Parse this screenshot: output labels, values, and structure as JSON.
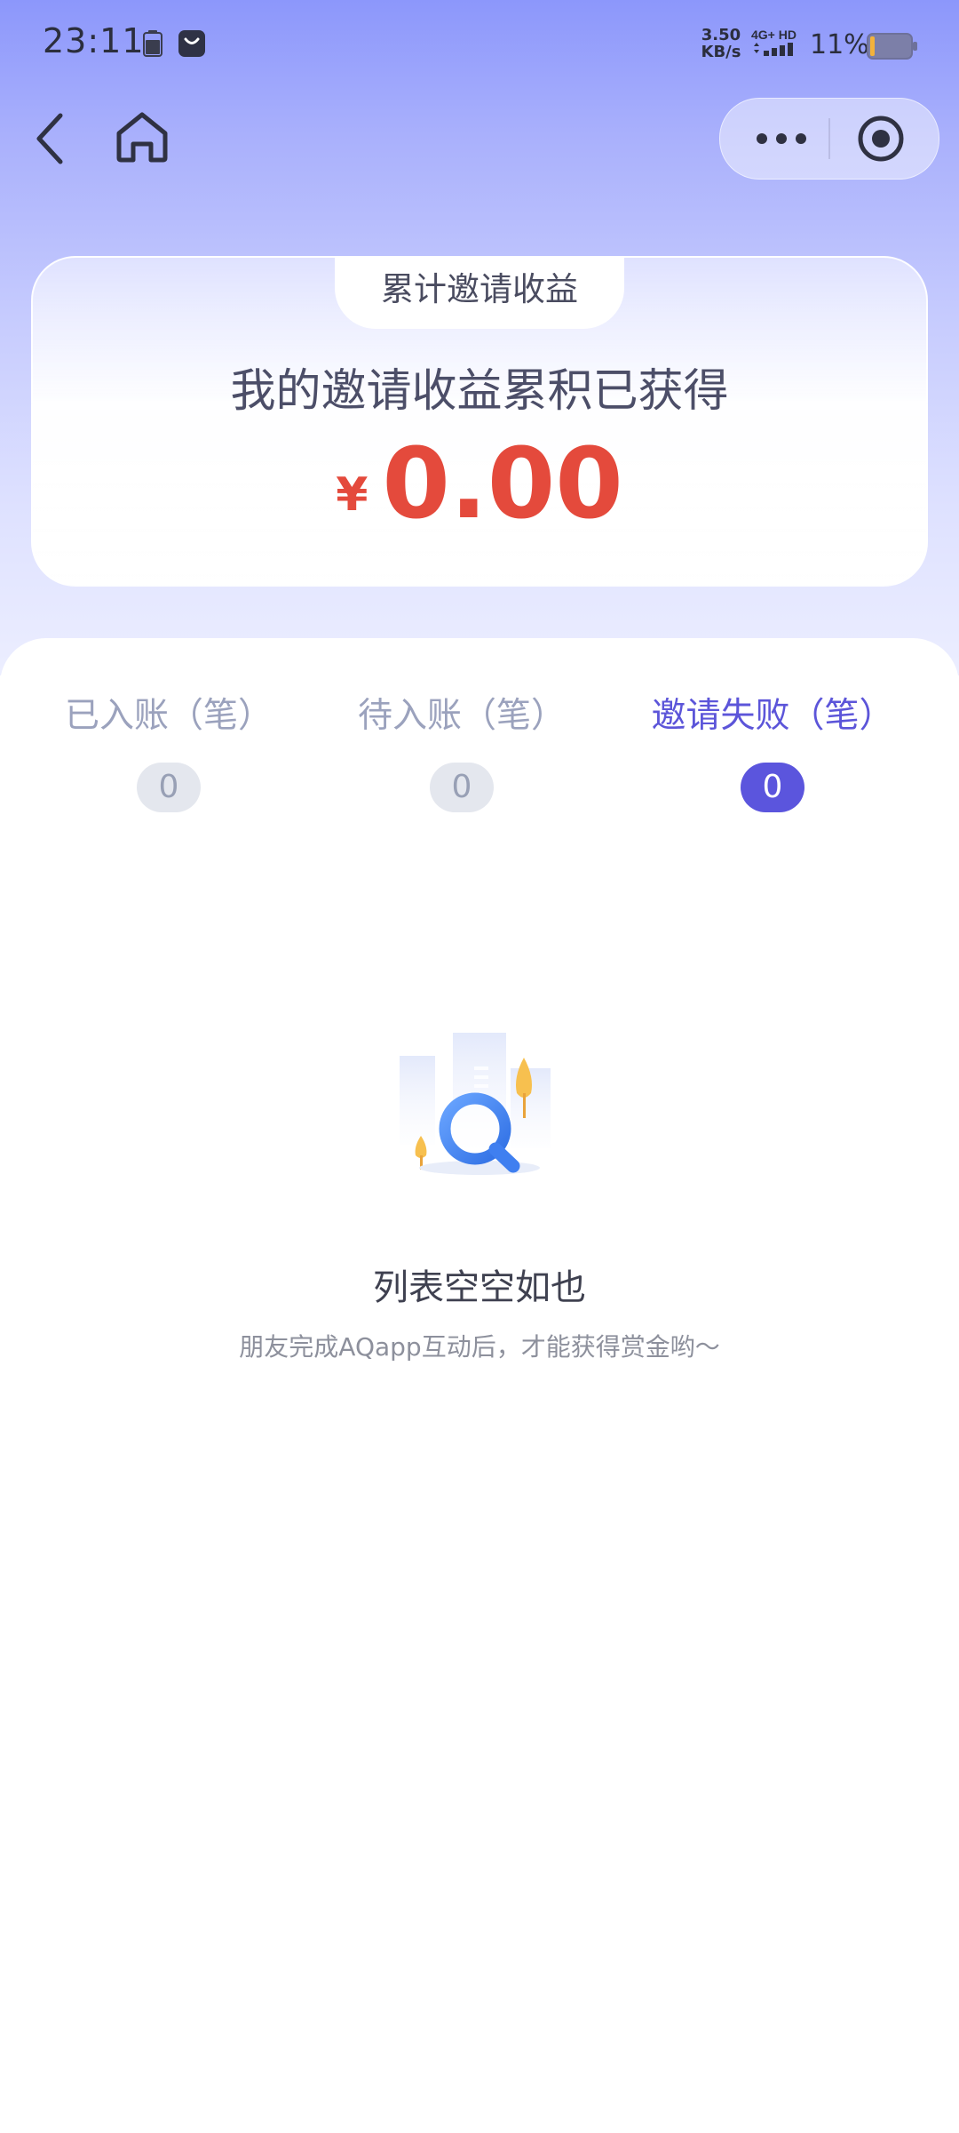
{
  "status_bar": {
    "time": "23:11",
    "net_speed_value": "3.50",
    "net_speed_unit": "KB/s",
    "network_label": "4G+ HD",
    "battery_percent": "11%",
    "battery_level": 0.11,
    "icons": [
      "battery-small-icon",
      "store-bag-icon",
      "signal-icon",
      "battery-icon"
    ]
  },
  "nav": {
    "icons": [
      "back-icon",
      "home-icon",
      "more-icon",
      "close-target-icon"
    ]
  },
  "income_card": {
    "tab_label": "累计邀请收益",
    "headline": "我的邀请收益累积已获得",
    "currency": "¥",
    "amount": "0.00"
  },
  "tabs": [
    {
      "label": "已入账（笔）",
      "count": "0",
      "active": false
    },
    {
      "label": "待入账（笔）",
      "count": "0",
      "active": false
    },
    {
      "label": "邀请失败（笔）",
      "count": "0",
      "active": true
    }
  ],
  "empty_state": {
    "icon": "magnifier-city-illustration",
    "title": "列表空空如也",
    "description": "朋友完成AQapp互动后，才能获得赏金哟～"
  },
  "colors": {
    "accent": "#5b55dd",
    "amount": "#e44a3c",
    "inactive_tab": "#9ba2bd"
  }
}
